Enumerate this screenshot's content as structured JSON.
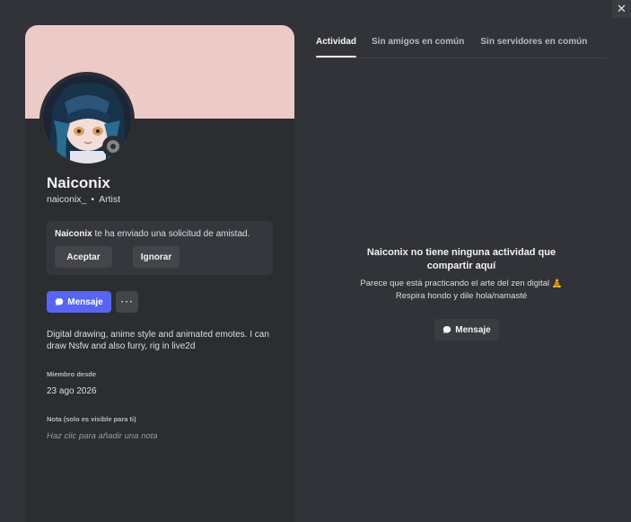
{
  "window": {
    "close_glyph": "✕"
  },
  "profile": {
    "banner_color": "#eccac7",
    "display_name": "Naiconix",
    "username": "naiconix_",
    "separator": "•",
    "pronoun_tag": "Artist",
    "status": "offline",
    "friend_request": {
      "name": "Naiconix",
      "text": " te ha enviado una solicitud de amistad.",
      "accept_label": "Aceptar",
      "ignore_label": "Ignorar"
    },
    "message_label": "Mensaje",
    "more_glyph": "···",
    "bio": "Digital drawing, anime style and animated emotes. I can draw Nsfw and also furry, rig in live2d",
    "member_since_label": "Miembro desde",
    "member_since": "23 ago 2026",
    "note_label": "Nota (solo es visible para ti)",
    "note_placeholder": "Haz clic para añadir una nota"
  },
  "tabs": [
    {
      "label": "Actividad",
      "active": true
    },
    {
      "label": "Sin amigos en común",
      "active": false
    },
    {
      "label": "Sin servidores en común",
      "active": false
    }
  ],
  "activity_empty": {
    "title": "Naiconix no tiene ninguna actividad que compartir aquí",
    "subtitle": "Parece que está practicando el arte del zen digital 🧘 Respira hondo y dile hola/namasté",
    "button_label": "Mensaje"
  },
  "colors": {
    "accent": "#5865f2",
    "background": "#313338",
    "card": "#2b2d31"
  }
}
